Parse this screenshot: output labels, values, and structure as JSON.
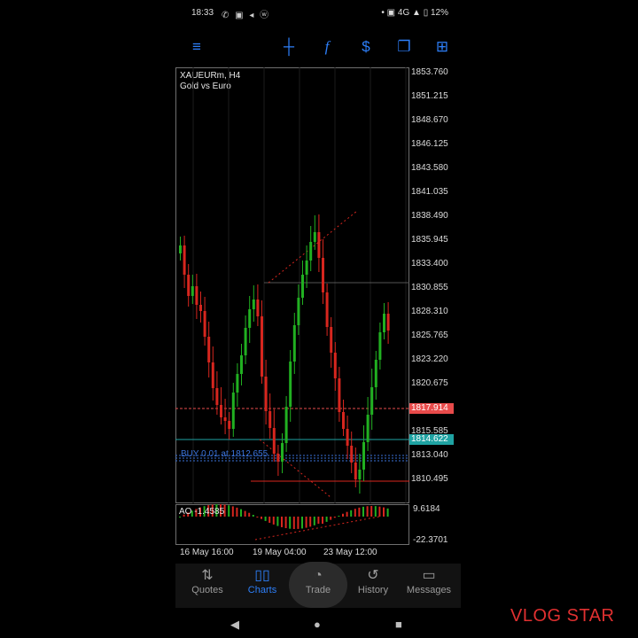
{
  "status_bar": {
    "time": "18:33",
    "notifications": "✆ ▣ ◂ ⓦ",
    "right": "• ▣ 4G ▲ ▯ 12%"
  },
  "toolbar": {
    "menu_icon": "menu-icon",
    "crosshair_icon": "crosshair-icon",
    "indicators_icon": "f",
    "dollar_icon": "$",
    "windows_icon": "windows-icon",
    "add_icon": "add-order-icon"
  },
  "chart": {
    "symbol": "XAUEURm, H4",
    "description": "Gold vs Euro",
    "price_labels": [
      "1853.760",
      "1851.215",
      "1848.670",
      "1846.125",
      "1843.580",
      "1841.035",
      "1838.490",
      "1835.945",
      "1833.400",
      "1830.855",
      "1828.310",
      "1825.765",
      "1823.220",
      "1820.675",
      "1815.585",
      "1813.040",
      "1810.495"
    ],
    "ask_price": "1817.914",
    "bid_price": "1814.622",
    "order_line": "BUY 0.01 at 1812.655",
    "ao_label": "AO -1.4585",
    "ao_max": "9.6184",
    "ao_min": "-22.3701",
    "time_labels": [
      "16 May 16:00",
      "19 May 04:00",
      "23 May 12:00"
    ],
    "colors": {
      "bull": "#21b021",
      "bear": "#d7261e",
      "ask": "#e84b4b",
      "bid": "#1fa3a3"
    }
  },
  "bottom_nav": {
    "items": [
      {
        "label": "Quotes",
        "icon": "quotes-icon"
      },
      {
        "label": "Charts",
        "icon": "charts-icon"
      },
      {
        "label": "Trade",
        "icon": "trade-icon"
      },
      {
        "label": "History",
        "icon": "history-icon"
      },
      {
        "label": "Messages",
        "icon": "messages-icon"
      }
    ]
  },
  "watermark": "VLOG STAR"
}
